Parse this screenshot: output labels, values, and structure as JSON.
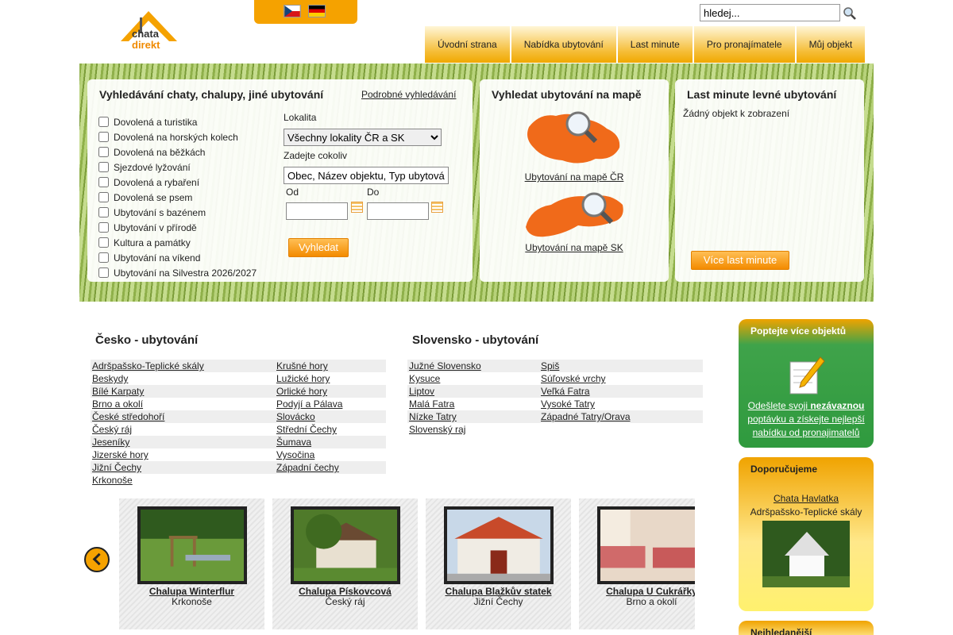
{
  "header": {
    "search_placeholder": "hledej...",
    "nav": [
      "Úvodní strana",
      "Nabídka ubytování",
      "Last minute",
      "Pro pronajímatele",
      "Můj objekt"
    ]
  },
  "search_panel": {
    "title": "Vyhledávání chaty, chalupy, jiné ubytování",
    "advanced_link": "Podrobné vyhledávání",
    "checkboxes": [
      "Dovolená a turistika",
      "Dovolená na horských kolech",
      "Dovolená na běžkách",
      "Sjezdové lyžování",
      "Dovolená a rybaření",
      "Dovolená se psem",
      "Ubytování s bazénem",
      "Ubytování v přírodě",
      "Kultura a památky",
      "Ubytování na víkend",
      "Ubytování na Silvestra 2026/2027"
    ],
    "locality_label": "Lokalita",
    "locality_value": "Všechny lokality ČR a SK",
    "anything_label": "Zadejte cokoliv",
    "anything_placeholder": "Obec, Název objektu, Typ ubytování",
    "from_label": "Od",
    "to_label": "Do",
    "submit": "Vyhledat"
  },
  "map_panel": {
    "title": "Vyhledat ubytování na mapě",
    "link_cz": "Ubytování na mapě ČR",
    "link_sk": "Ubytování na mapě SK"
  },
  "lastminute_panel": {
    "title": "Last minute levné ubytování",
    "empty": "Žádný objekt k zobrazení",
    "more": "Více last minute"
  },
  "regions": {
    "cz_title": "Česko - ubytování",
    "cz_col1": [
      "Adršpašsko-Teplické skály",
      "Beskydy",
      "Bílé Karpaty",
      "Brno a okolí",
      "České středohoří",
      "Český ráj",
      "Jeseníky",
      "Jizerské hory",
      "Jižní Čechy",
      "Krkonoše"
    ],
    "cz_col2": [
      "Krušné hory",
      "Lužické hory",
      "Orlické hory",
      "Podyjí a Pálava",
      "Slovácko",
      "Střední Čechy",
      "Šumava",
      "Vysočina",
      "Západní čechy"
    ],
    "sk_title": "Slovensko - ubytování",
    "sk_col1": [
      "Južné Slovensko",
      "Kysuce",
      "Liptov",
      "Malá Fatra",
      "Nízke Tatry",
      "Slovenský raj"
    ],
    "sk_col2": [
      "Spiš",
      "Súľovské vrchy",
      "Veľká Fatra",
      "Vysoké Tatry",
      "Západné Tatry/Orava"
    ]
  },
  "carousel": [
    {
      "name": "Chalupa Winterflur",
      "loc": "Krkonoše"
    },
    {
      "name": "Chalupa Pískovcová",
      "loc": "Český ráj"
    },
    {
      "name": "Chalupa Blažkův statek",
      "loc": "Jižní Čechy"
    },
    {
      "name": "Chalupa U Cukrářky",
      "loc": "Brno a okolí"
    }
  ],
  "sidebar": {
    "request_title": "Poptejte více objektů",
    "request_text_1": "Odešlete svoji ",
    "request_text_bold": "nezávaznou",
    "request_text_2": " poptávku a získejte nejlepší nabídku od pronajimatelů",
    "recommend_title": "Doporučujeme",
    "recommend_name": "Chata Havlatka",
    "recommend_loc": "Adršpašsko-Teplické skály",
    "most_title": "Nejhledanější"
  },
  "colors": {
    "accent": "#f5a200",
    "green": "#2f9a3e"
  }
}
